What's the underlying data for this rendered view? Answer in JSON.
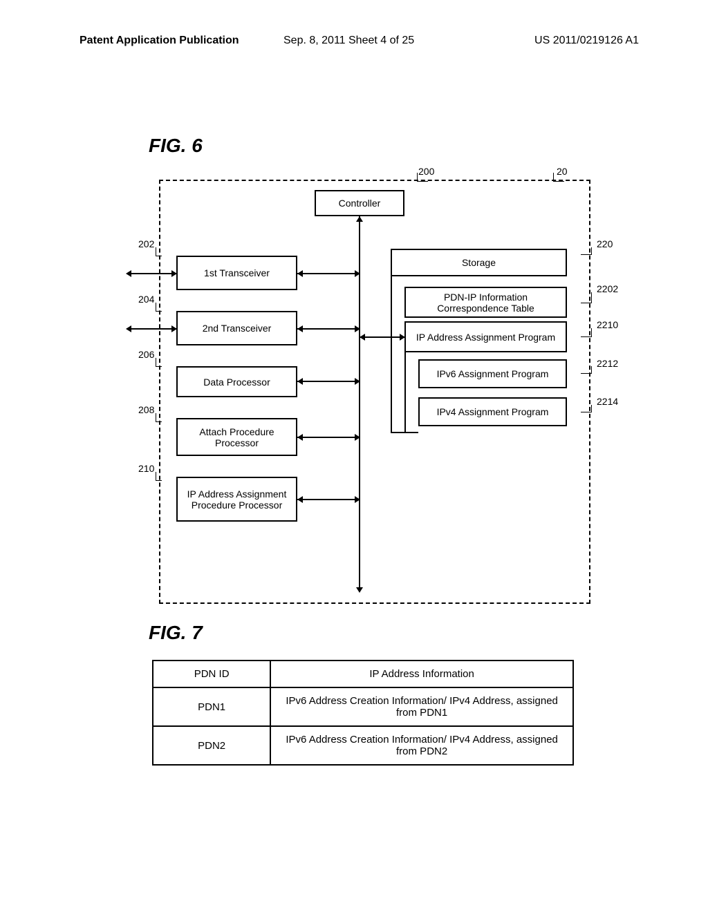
{
  "header": {
    "left": "Patent Application Publication",
    "center": "Sep. 8, 2011  Sheet 4 of 25",
    "right": "US 2011/0219126 A1"
  },
  "fig6": {
    "title": "FIG. 6",
    "ref_200": "200",
    "ref_20": "20",
    "blocks": {
      "controller": "Controller",
      "transceiver1": "1st Transceiver",
      "transceiver2": "2nd Transceiver",
      "data_processor": "Data Processor",
      "attach": "Attach Procedure Processor",
      "ip_assign_proc": "IP Address Assignment Procedure Processor",
      "storage": "Storage",
      "pdn_table": "PDN-IP Information Correspondence Table",
      "ip_program": "IP Address Assignment Program",
      "ipv6_program": "IPv6 Assignment Program",
      "ipv4_program": "IPv4 Assignment Program"
    },
    "refs": {
      "r202": "202",
      "r204": "204",
      "r206": "206",
      "r208": "208",
      "r210": "210",
      "r220": "220",
      "r2202": "2202",
      "r2210": "2210",
      "r2212": "2212",
      "r2214": "2214"
    }
  },
  "fig7": {
    "title": "FIG. 7",
    "table": {
      "headers": [
        "PDN ID",
        "IP Address Information"
      ],
      "rows": [
        {
          "pdn": "PDN1",
          "info": "IPv6 Address Creation Information/ IPv4 Address, assigned from PDN1"
        },
        {
          "pdn": "PDN2",
          "info": "IPv6 Address Creation Information/ IPv4 Address, assigned from PDN2"
        }
      ]
    }
  }
}
